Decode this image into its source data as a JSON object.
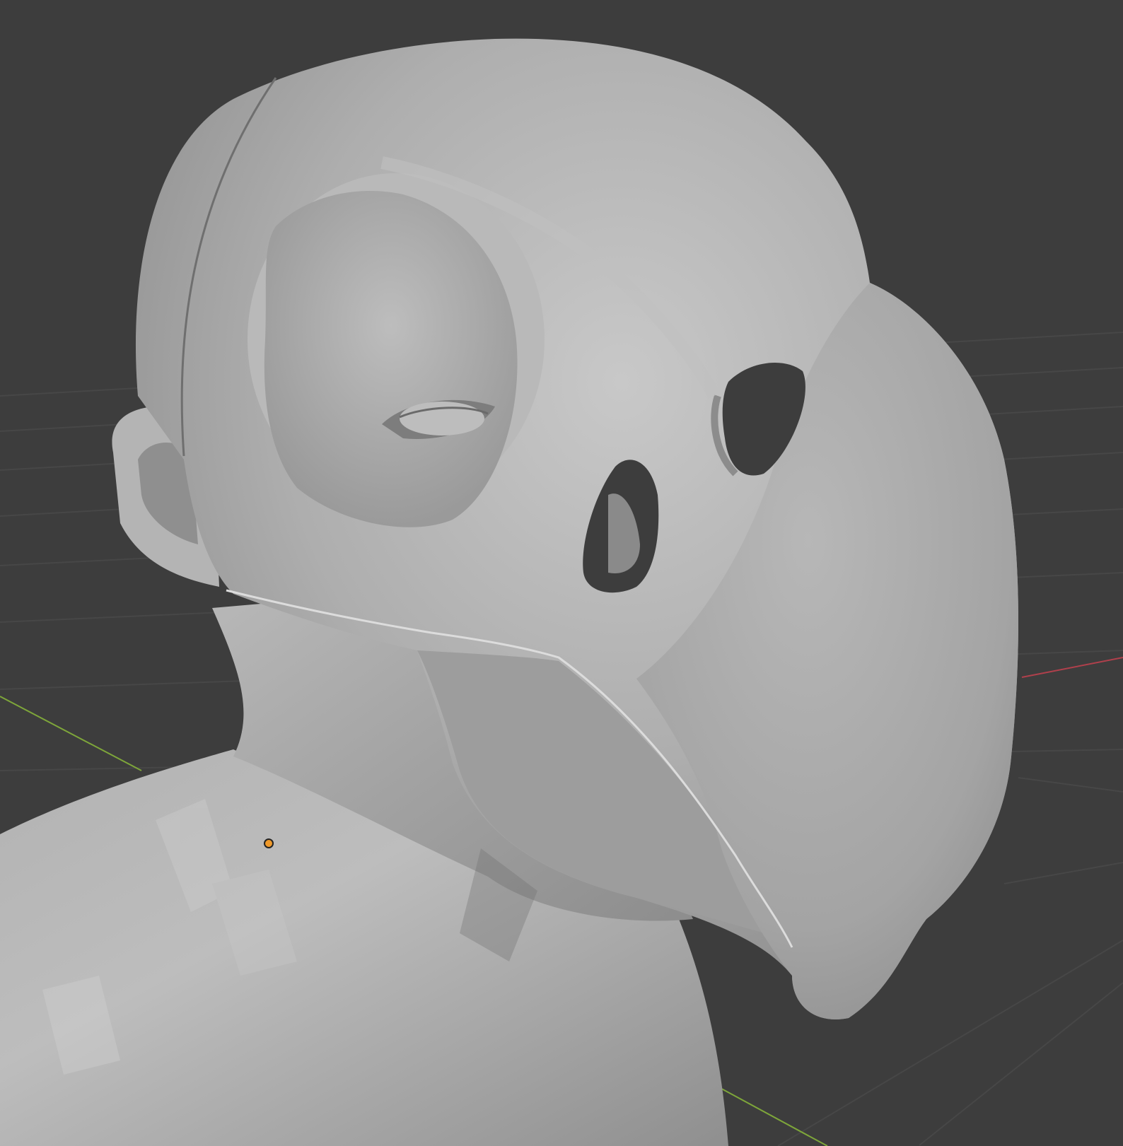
{
  "viewport": {
    "background": "#3d3d3d",
    "grid_color": "#454545",
    "x_axis_color": "#b0404c",
    "y_axis_color": "#7ea63a",
    "origin_color": "#f09a2b"
  },
  "model": {
    "mesh_color": "#a9a9a9",
    "shade_dark": "#7b7b7b",
    "shade_light": "#c4c4c4",
    "hole_color": "#3d3d3d"
  },
  "icons": {
    "origin_point": "object-origin-icon"
  }
}
